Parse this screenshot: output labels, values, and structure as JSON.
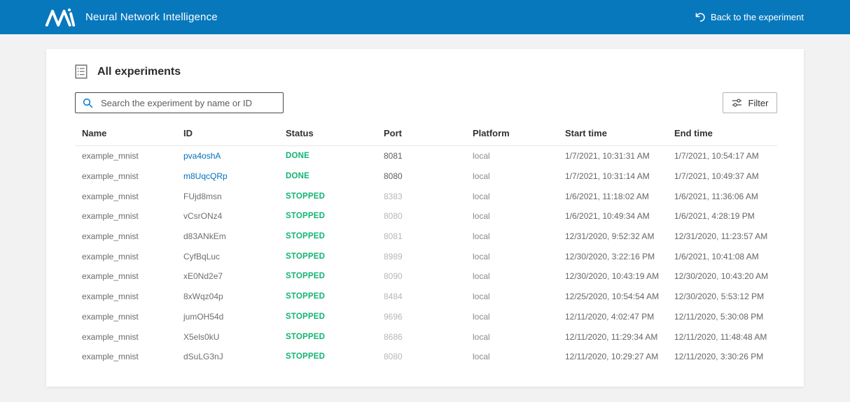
{
  "header": {
    "brand": "Neural Network Intelligence",
    "back_label": "Back to the experiment"
  },
  "page": {
    "title": "All experiments",
    "search_placeholder": "Search the experiment by name or ID",
    "search_value": "",
    "filter_label": "Filter"
  },
  "table": {
    "columns": [
      "Name",
      "ID",
      "Status",
      "Port",
      "Platform",
      "Start time",
      "End time"
    ],
    "rows": [
      {
        "name": "example_mnist",
        "id": "pva4oshA",
        "id_link": true,
        "status": "DONE",
        "port": "8081",
        "port_active": true,
        "platform": "local",
        "start": "1/7/2021, 10:31:31 AM",
        "end": "1/7/2021, 10:54:17 AM"
      },
      {
        "name": "example_mnist",
        "id": "m8UqcQRp",
        "id_link": true,
        "status": "DONE",
        "port": "8080",
        "port_active": true,
        "platform": "local",
        "start": "1/7/2021, 10:31:14 AM",
        "end": "1/7/2021, 10:49:37 AM"
      },
      {
        "name": "example_mnist",
        "id": "FUjd8msn",
        "id_link": false,
        "status": "STOPPED",
        "port": "8383",
        "port_active": false,
        "platform": "local",
        "start": "1/6/2021, 11:18:02 AM",
        "end": "1/6/2021, 11:36:06 AM"
      },
      {
        "name": "example_mnist",
        "id": "vCsrONz4",
        "id_link": false,
        "status": "STOPPED",
        "port": "8080",
        "port_active": false,
        "platform": "local",
        "start": "1/6/2021, 10:49:34 AM",
        "end": "1/6/2021, 4:28:19 PM"
      },
      {
        "name": "example_mnist",
        "id": "d83ANkEm",
        "id_link": false,
        "status": "STOPPED",
        "port": "8081",
        "port_active": false,
        "platform": "local",
        "start": "12/31/2020, 9:52:32 AM",
        "end": "12/31/2020, 11:23:57 AM"
      },
      {
        "name": "example_mnist",
        "id": "CyfBqLuc",
        "id_link": false,
        "status": "STOPPED",
        "port": "8989",
        "port_active": false,
        "platform": "local",
        "start": "12/30/2020, 3:22:16 PM",
        "end": "1/6/2021, 10:41:08 AM"
      },
      {
        "name": "example_mnist",
        "id": "xE0Nd2e7",
        "id_link": false,
        "status": "STOPPED",
        "port": "8090",
        "port_active": false,
        "platform": "local",
        "start": "12/30/2020, 10:43:19 AM",
        "end": "12/30/2020, 10:43:20 AM"
      },
      {
        "name": "example_mnist",
        "id": "8xWqz04p",
        "id_link": false,
        "status": "STOPPED",
        "port": "8484",
        "port_active": false,
        "platform": "local",
        "start": "12/25/2020, 10:54:54 AM",
        "end": "12/30/2020, 5:53:12 PM"
      },
      {
        "name": "example_mnist",
        "id": "jumOH54d",
        "id_link": false,
        "status": "STOPPED",
        "port": "9696",
        "port_active": false,
        "platform": "local",
        "start": "12/11/2020, 4:02:47 PM",
        "end": "12/11/2020, 5:30:08 PM"
      },
      {
        "name": "example_mnist",
        "id": "X5els0kU",
        "id_link": false,
        "status": "STOPPED",
        "port": "8686",
        "port_active": false,
        "platform": "local",
        "start": "12/11/2020, 11:29:34 AM",
        "end": "12/11/2020, 11:48:48 AM"
      },
      {
        "name": "example_mnist",
        "id": "dSuLG3nJ",
        "id_link": false,
        "status": "STOPPED",
        "port": "8080",
        "port_active": false,
        "platform": "local",
        "start": "12/11/2020, 10:29:27 AM",
        "end": "12/11/2020, 3:30:26 PM"
      }
    ]
  },
  "icons": {
    "logo": "nni-logo",
    "back": "back-arrow-icon",
    "title": "experiments-list-icon",
    "search": "search-icon",
    "filter": "filter-sliders-icon"
  },
  "colors": {
    "header_bg": "#0878bd",
    "status_green": "#12b472",
    "link_blue": "#0071bc",
    "page_bg": "#f2f2f2"
  }
}
